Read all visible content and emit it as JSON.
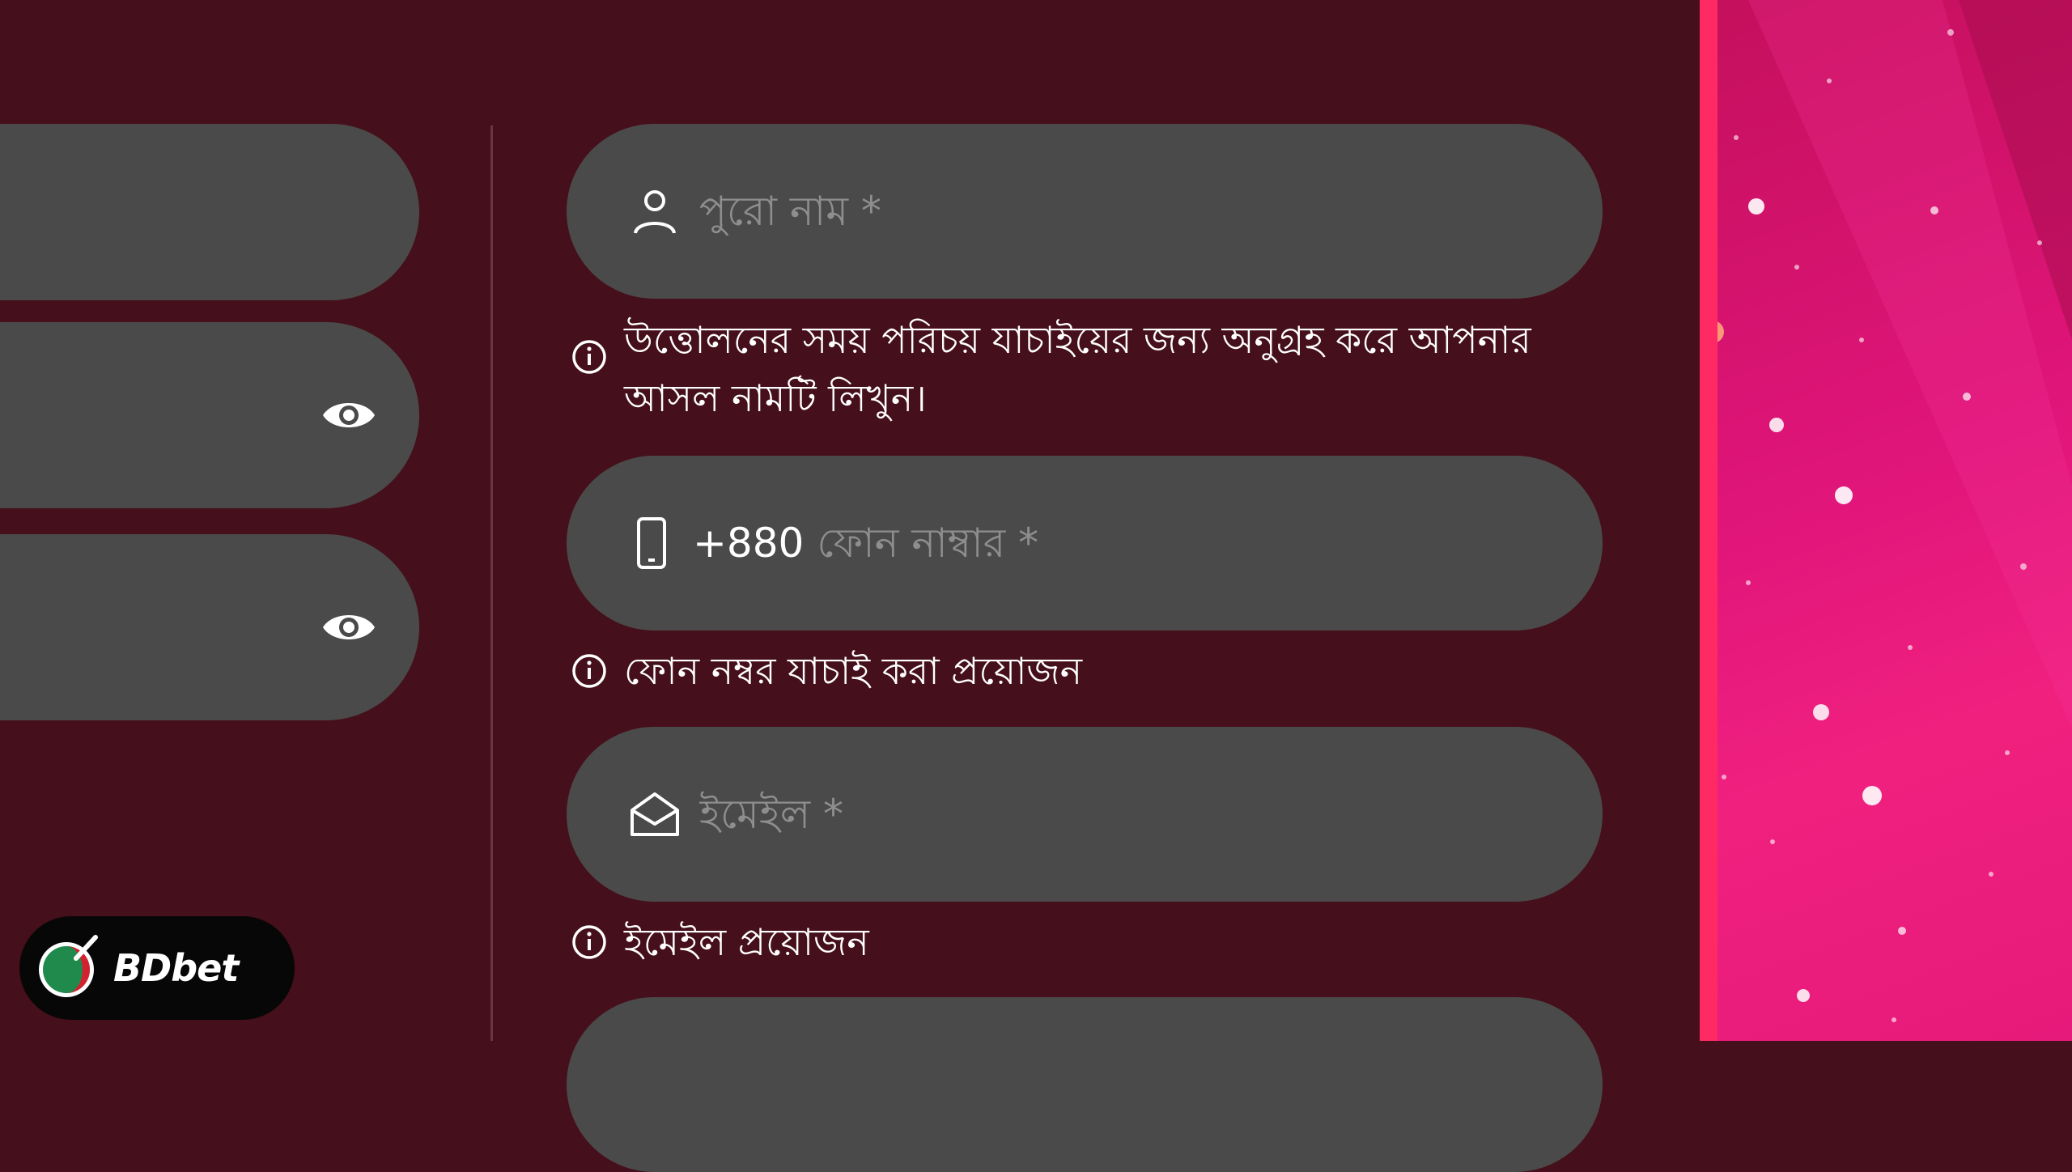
{
  "form": {
    "full_name": {
      "placeholder": "পুরো নাম *",
      "hint": "উত্তোলনের সময় পরিচয় যাচাইয়ের জন্য অনুগ্রহ করে আপনার আসল নামটি লিখুন।"
    },
    "phone": {
      "prefix": "+880",
      "placeholder": "ফোন নাম্বার *",
      "hint": "ফোন নম্বর যাচাই করা প্রয়োজন"
    },
    "email": {
      "placeholder": "ইমেইল *",
      "hint": "ইমেইল প্রয়োজন"
    }
  },
  "icons": {
    "name_field": "user-icon",
    "phone_field": "phone-icon",
    "email_field": "envelope-open-icon",
    "hint": "info-icon",
    "password_toggle": "eye-icon"
  },
  "logo": {
    "text": "BDbet"
  },
  "colors": {
    "background": "#450f1b",
    "field": "#4a4a4a",
    "placeholder": "#8e8e8e",
    "side_panel": "#e0157a",
    "side_accent": "#ff2a63"
  }
}
